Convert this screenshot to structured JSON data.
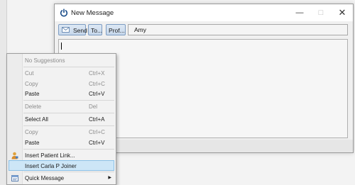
{
  "window": {
    "title": "New Message",
    "app_icon": "power-icon",
    "controls": {
      "minimize": "—",
      "maximize": "□",
      "close": "✕"
    }
  },
  "toolbar": {
    "send_label": "Send",
    "send_icon": "send-icon",
    "to_label": "To...",
    "prof_label": "Prof...",
    "to_field_value": "Amy"
  },
  "context_menu": {
    "items": [
      {
        "label": "No Suggestions",
        "shortcut": "",
        "disabled": true
      },
      {
        "label": "Cut",
        "shortcut": "Ctrl+X",
        "disabled": true
      },
      {
        "label": "Copy",
        "shortcut": "Ctrl+C",
        "disabled": true
      },
      {
        "label": "Paste",
        "shortcut": "Ctrl+V",
        "disabled": false
      },
      {
        "label": "Delete",
        "shortcut": "Del",
        "disabled": true
      },
      {
        "label": "Select All",
        "shortcut": "Ctrl+A",
        "disabled": false
      },
      {
        "label": "Copy",
        "shortcut": "Ctrl+C",
        "disabled": true
      },
      {
        "label": "Paste",
        "shortcut": "Ctrl+V",
        "disabled": false
      },
      {
        "label": "Insert Patient Link...",
        "shortcut": "",
        "disabled": false,
        "icon": "patient-icon"
      },
      {
        "label": "Insert Carla P Joiner",
        "shortcut": "",
        "disabled": false,
        "highlighted": true
      },
      {
        "label": "Quick Message",
        "shortcut": "",
        "disabled": false,
        "icon": "message-icon",
        "submenu_arrow": "▶"
      }
    ]
  }
}
